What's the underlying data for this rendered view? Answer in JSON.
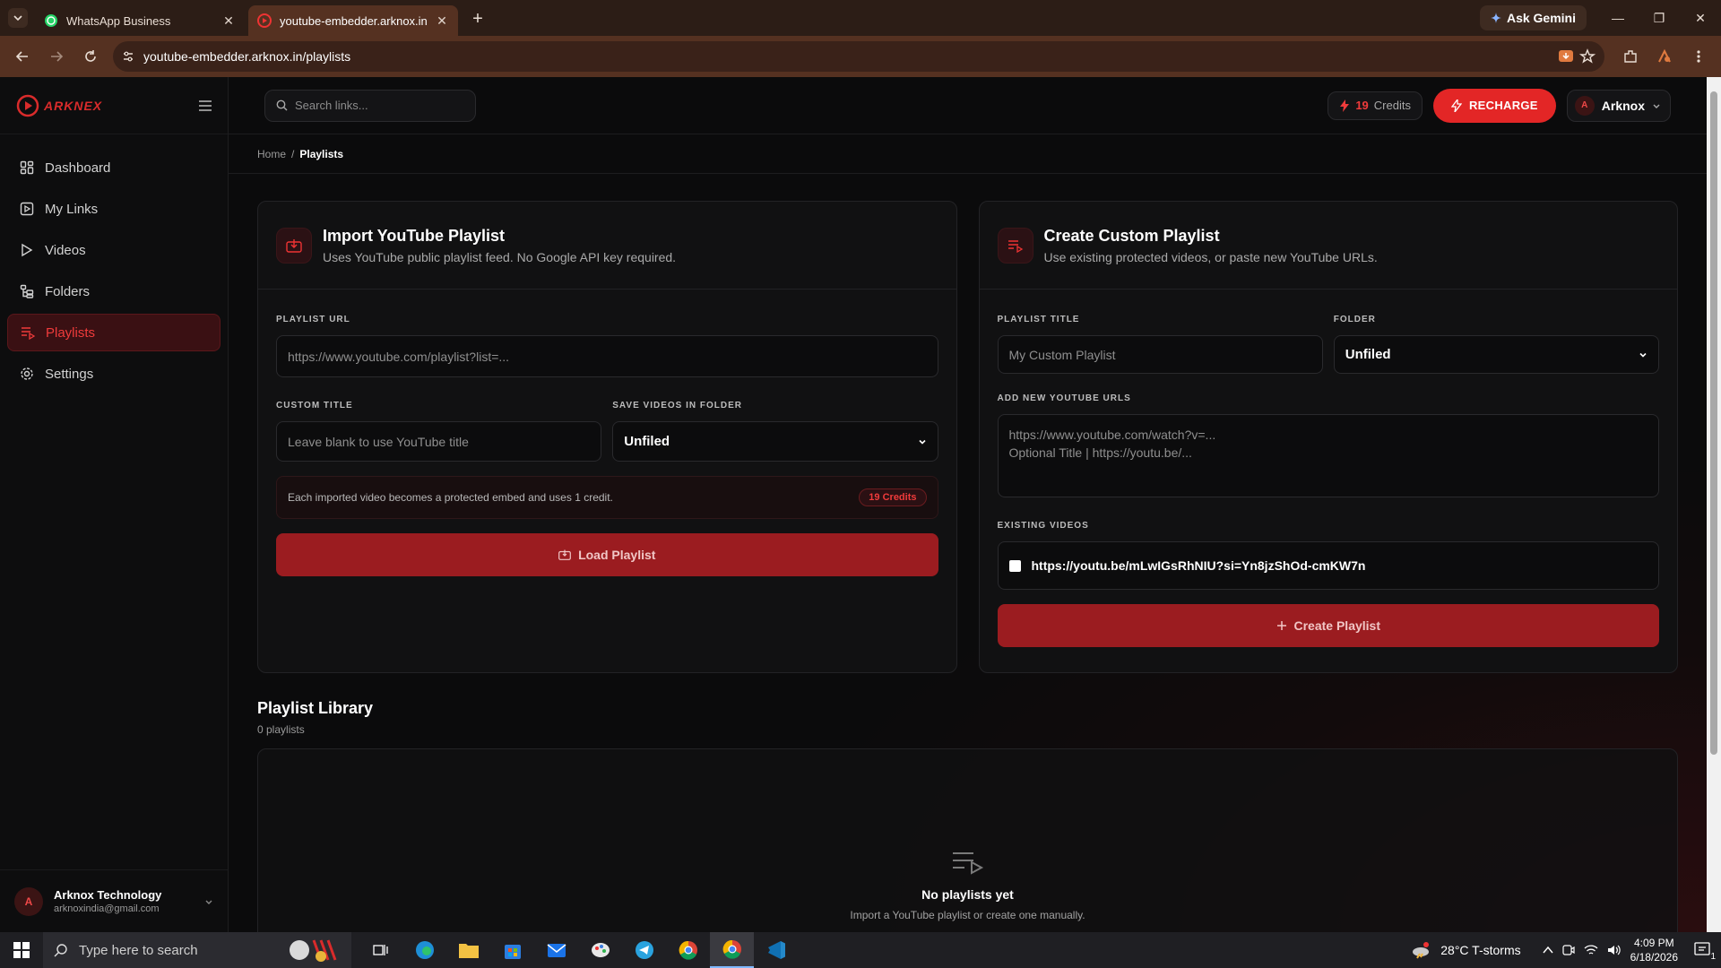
{
  "browser": {
    "tabs": [
      {
        "title": "WhatsApp Business",
        "icon": "whatsapp-icon"
      },
      {
        "title": "youtube-embedder.arknox.in/p",
        "icon": "youtube-icon"
      }
    ],
    "ask_gemini": "Ask Gemini",
    "url": "youtube-embedder.arknox.in/playlists"
  },
  "app": {
    "brand": "ARKNEX",
    "nav": [
      {
        "label": "Dashboard",
        "icon": "dashboard-icon"
      },
      {
        "label": "My Links",
        "icon": "link-icon"
      },
      {
        "label": "Videos",
        "icon": "play-icon"
      },
      {
        "label": "Folders",
        "icon": "folder-icon"
      },
      {
        "label": "Playlists",
        "icon": "playlist-icon",
        "active": true
      },
      {
        "label": "Settings",
        "icon": "gear-icon"
      }
    ],
    "user": {
      "initial": "A",
      "name": "Arknox Technology",
      "email": "arknoxindia@gmail.com"
    },
    "search_placeholder": "Search links...",
    "credits": {
      "count": "19",
      "label": "Credits"
    },
    "recharge": "RECHARGE",
    "account": {
      "initial": "A",
      "name": "Arknox"
    },
    "breadcrumb": {
      "home": "Home",
      "sep": "/",
      "current": "Playlists"
    },
    "import_card": {
      "title": "Import YouTube Playlist",
      "subtitle": "Uses YouTube public playlist feed. No Google API key required.",
      "url_label": "PLAYLIST URL",
      "url_placeholder": "https://www.youtube.com/playlist?list=...",
      "title_label": "CUSTOM TITLE",
      "title_placeholder": "Leave blank to use YouTube title",
      "folder_label": "SAVE VIDEOS IN FOLDER",
      "folder_value": "Unfiled",
      "notice": "Each imported video becomes a protected embed and uses 1 credit.",
      "notice_badge": "19 Credits",
      "button": "Load Playlist"
    },
    "custom_card": {
      "title": "Create Custom Playlist",
      "subtitle": "Use existing protected videos, or paste new YouTube URLs.",
      "title_label": "PLAYLIST TITLE",
      "title_placeholder": "My Custom Playlist",
      "folder_label": "FOLDER",
      "folder_value": "Unfiled",
      "urls_label": "ADD NEW YOUTUBE URLS",
      "urls_placeholder_line1": "https://www.youtube.com/watch?v=...",
      "urls_placeholder_line2": "Optional Title | https://youtu.be/...",
      "existing_label": "EXISTING VIDEOS",
      "existing_video": "https://youtu.be/mLwIGsRhNIU?si=Yn8jzShOd-cmKW7n",
      "button": "Create Playlist"
    },
    "library": {
      "title": "Playlist Library",
      "count": "0 playlists",
      "empty_title": "No playlists yet",
      "empty_sub": "Import a YouTube playlist or create one manually."
    }
  },
  "taskbar": {
    "search_placeholder": "Type here to search",
    "weather": "28°C  T-storms",
    "time": "4:09 PM",
    "date": "6/18/2026",
    "notification_count": "1"
  },
  "colors": {
    "accent": "#e32626",
    "accent_dark": "#9b1c20",
    "active_nav": "#ef3b3b"
  }
}
